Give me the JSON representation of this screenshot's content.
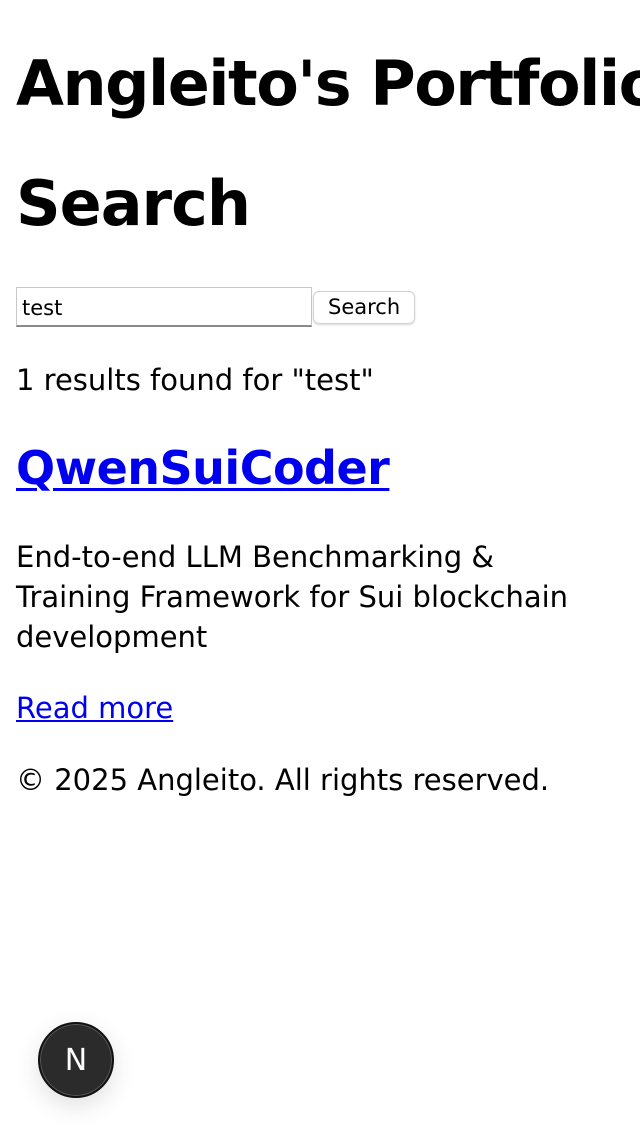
{
  "site": {
    "title": "Angleito's Portfolio"
  },
  "search": {
    "heading": "Search",
    "query": "test",
    "button_label": "Search",
    "results_text": "1 results found for \"test\""
  },
  "results": [
    {
      "title": "QwenSuiCoder",
      "description": "End-to-end LLM Benchmarking & Training Framework for Sui blockchain development",
      "link_label": "Read more"
    }
  ],
  "footer": {
    "copyright": "© 2025 Angleito. All rights reserved."
  },
  "dev_indicator": {
    "label": "N",
    "icon": "nextjs-icon"
  }
}
